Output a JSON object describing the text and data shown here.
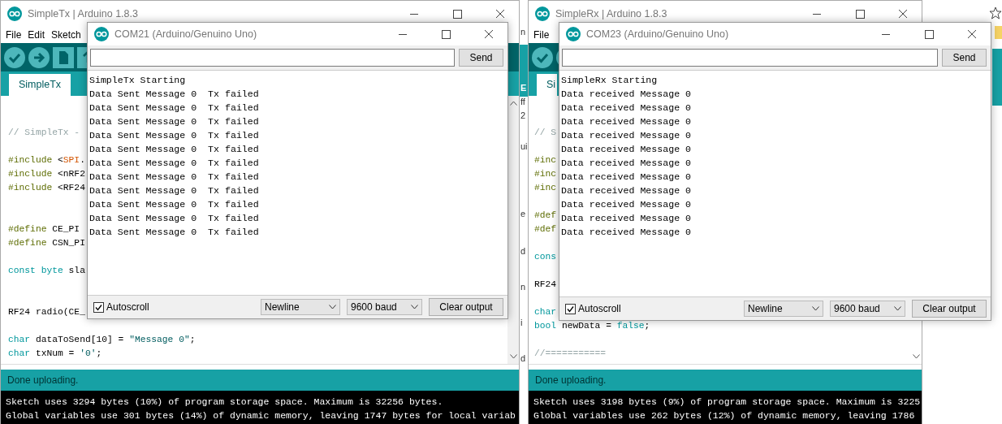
{
  "background_window": {
    "fragments": [
      "n",
      "E",
      "ff",
      "2",
      "ui",
      "e",
      "d",
      "n",
      "i",
      "d"
    ]
  },
  "ides": [
    {
      "title": "SimpleTx | Arduino 1.8.3",
      "menu": [
        "File",
        "Edit",
        "Sketch"
      ],
      "toolbar": [
        {
          "kind": "verify"
        },
        {
          "kind": "upload"
        },
        {
          "kind": "new"
        },
        {
          "kind": "open"
        }
      ],
      "tab": {
        "label": "SimpleTx",
        "selected": true
      },
      "code_lines": [
        {
          "kind": "blank"
        },
        {
          "kind": "blank"
        },
        {
          "kind": "code",
          "tokens": [
            {
              "text": "// SimpleTx -",
              "kind": "comment"
            }
          ]
        },
        {
          "kind": "blank"
        },
        {
          "kind": "code",
          "tokens": [
            {
              "text": "#include",
              "kind": "pre"
            },
            {
              "text": " <",
              "kind": "plain"
            },
            {
              "text": "SPI",
              "kind": "lib"
            },
            {
              "text": ".",
              "kind": "plain"
            }
          ]
        },
        {
          "kind": "code",
          "tokens": [
            {
              "text": "#include",
              "kind": "pre"
            },
            {
              "text": " <nRF2",
              "kind": "plain"
            }
          ]
        },
        {
          "kind": "code",
          "tokens": [
            {
              "text": "#include",
              "kind": "pre"
            },
            {
              "text": " <RF24",
              "kind": "plain"
            }
          ]
        },
        {
          "kind": "blank"
        },
        {
          "kind": "blank"
        },
        {
          "kind": "code",
          "tokens": [
            {
              "text": "#define",
              "kind": "pre"
            },
            {
              "text": " CE_PI",
              "kind": "plain"
            }
          ]
        },
        {
          "kind": "code",
          "tokens": [
            {
              "text": "#define",
              "kind": "pre"
            },
            {
              "text": " CSN_PI",
              "kind": "plain"
            }
          ]
        },
        {
          "kind": "blank"
        },
        {
          "kind": "code",
          "tokens": [
            {
              "text": "const byte",
              "kind": "type"
            },
            {
              "text": " sla",
              "kind": "plain"
            }
          ]
        },
        {
          "kind": "blank"
        },
        {
          "kind": "blank"
        },
        {
          "kind": "code",
          "tokens": [
            {
              "text": "RF24 radio(CE_",
              "kind": "plain"
            }
          ]
        },
        {
          "kind": "blank"
        },
        {
          "kind": "code",
          "tokens": [
            {
              "text": "char",
              "kind": "type"
            },
            {
              "text": " dataToSend[10] = ",
              "kind": "plain"
            },
            {
              "text": "\"Message 0\"",
              "kind": "string"
            },
            {
              "text": ";",
              "kind": "plain"
            }
          ]
        },
        {
          "kind": "code",
          "tokens": [
            {
              "text": "char",
              "kind": "type"
            },
            {
              "text": " txNum = ",
              "kind": "plain"
            },
            {
              "text": "'0'",
              "kind": "string"
            },
            {
              "text": ";",
              "kind": "plain"
            }
          ]
        }
      ],
      "status": "Done uploading.",
      "console": [
        "Sketch uses 3294 bytes (10%) of program storage space. Maximum is 32256 bytes.",
        "Global variables use 301 bytes (14%) of dynamic memory, leaving 1747 bytes for local variab"
      ],
      "serial_monitor": {
        "title": "COM21 (Arduino/Genuino Uno)",
        "send": "Send",
        "output": [
          "SimpleTx Starting",
          "Data Sent Message 0  Tx failed",
          "Data Sent Message 0  Tx failed",
          "Data Sent Message 0  Tx failed",
          "Data Sent Message 0  Tx failed",
          "Data Sent Message 0  Tx failed",
          "Data Sent Message 0  Tx failed",
          "Data Sent Message 0  Tx failed",
          "Data Sent Message 0  Tx failed",
          "Data Sent Message 0  Tx failed",
          "Data Sent Message 0  Tx failed",
          "Data Sent Message 0  Tx failed"
        ],
        "autoscroll": {
          "label": "Autoscroll",
          "checked": true
        },
        "line_ending": "Newline",
        "baud": "9600 baud",
        "clear": "Clear output"
      }
    },
    {
      "title": "SimpleRx | Arduino 1.8.3",
      "menu": [
        "File"
      ],
      "toolbar": [
        {
          "kind": "verify"
        },
        {
          "kind": "upload"
        }
      ],
      "tab": {
        "label": "Si",
        "selected": true
      },
      "code_lines": [
        {
          "kind": "blank"
        },
        {
          "kind": "blank"
        },
        {
          "kind": "code",
          "tokens": [
            {
              "text": "// S",
              "kind": "comment"
            }
          ]
        },
        {
          "kind": "blank"
        },
        {
          "kind": "code",
          "tokens": [
            {
              "text": "#inc",
              "kind": "pre"
            }
          ]
        },
        {
          "kind": "code",
          "tokens": [
            {
              "text": "#inc",
              "kind": "pre"
            }
          ]
        },
        {
          "kind": "code",
          "tokens": [
            {
              "text": "#inc",
              "kind": "pre"
            }
          ]
        },
        {
          "kind": "blank"
        },
        {
          "kind": "code",
          "tokens": [
            {
              "text": "#def",
              "kind": "pre"
            }
          ]
        },
        {
          "kind": "code",
          "tokens": [
            {
              "text": "#def",
              "kind": "pre"
            }
          ]
        },
        {
          "kind": "blank"
        },
        {
          "kind": "code",
          "tokens": [
            {
              "text": "cons",
              "kind": "type"
            }
          ]
        },
        {
          "kind": "blank"
        },
        {
          "kind": "code",
          "tokens": [
            {
              "text": "RF24",
              "kind": "plain"
            }
          ]
        },
        {
          "kind": "blank"
        },
        {
          "kind": "code",
          "tokens": [
            {
              "text": "char",
              "kind": "type"
            }
          ]
        },
        {
          "kind": "code",
          "tokens": [
            {
              "text": "bool",
              "kind": "type"
            },
            {
              "text": " newData = ",
              "kind": "plain"
            },
            {
              "text": "false",
              "kind": "type"
            },
            {
              "text": ";",
              "kind": "plain"
            }
          ]
        },
        {
          "kind": "blank"
        },
        {
          "kind": "code",
          "tokens": [
            {
              "text": "//===========",
              "kind": "comment"
            }
          ]
        }
      ],
      "status": "Done uploading.",
      "console": [
        "Sketch uses 3198 bytes (9%) of program storage space. Maximum is 3225",
        "Global variables use 262 bytes (12%) of dynamic memory, leaving 1786"
      ],
      "serial_monitor": {
        "title": "COM23 (Arduino/Genuino Uno)",
        "send": "Send",
        "output": [
          "SimpleRx Starting",
          "Data received Message 0",
          "Data received Message 0",
          "Data received Message 0",
          "Data received Message 0",
          "Data received Message 0",
          "Data received Message 0",
          "Data received Message 0",
          "Data received Message 0",
          "Data received Message 0",
          "Data received Message 0",
          "Data received Message 0"
        ],
        "autoscroll": {
          "label": "Autoscroll",
          "checked": true
        },
        "line_ending": "Newline",
        "baud": "9600 baud",
        "clear": "Clear output"
      }
    }
  ]
}
